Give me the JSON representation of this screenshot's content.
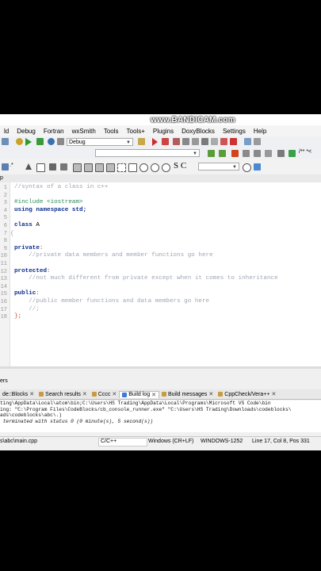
{
  "watermark": "www.BANDICAM.com",
  "menu": [
    "ld",
    "Debug",
    "Fortran",
    "wxSmith",
    "Tools",
    "Tools+",
    "Plugins",
    "DoxyBlocks",
    "Settings",
    "Help"
  ],
  "toolbar": {
    "build_target": "Debug",
    "comment_hint": "/** *<"
  },
  "toolbar2": {
    "search_letters": "S C"
  },
  "editor": {
    "tab_label": "p",
    "lines": [
      {
        "n": "1",
        "fold": "",
        "parts": [
          {
            "c": "comment",
            "t": "//syntax of a class in c++"
          }
        ]
      },
      {
        "n": "2",
        "fold": "",
        "parts": []
      },
      {
        "n": "3",
        "fold": "",
        "parts": [
          {
            "c": "pre",
            "t": "#include <iostream>"
          }
        ]
      },
      {
        "n": "4",
        "fold": "",
        "parts": [
          {
            "c": "kw",
            "t": "using namespace "
          },
          {
            "c": "kw",
            "t": "std;"
          }
        ]
      },
      {
        "n": "5",
        "fold": "",
        "parts": []
      },
      {
        "n": "6",
        "fold": "",
        "parts": [
          {
            "c": "kw",
            "t": "class "
          },
          {
            "c": "norm",
            "t": "A"
          }
        ]
      },
      {
        "n": "7",
        "fold": "{",
        "parts": []
      },
      {
        "n": "8",
        "fold": "",
        "parts": []
      },
      {
        "n": "9",
        "fold": "",
        "parts": [
          {
            "c": "kw",
            "t": "private"
          },
          {
            "c": "punc",
            "t": ":"
          }
        ]
      },
      {
        "n": "10",
        "fold": "",
        "parts": [
          {
            "c": "comment",
            "t": "    //private data members and member functions go here"
          }
        ]
      },
      {
        "n": "11",
        "fold": "",
        "parts": []
      },
      {
        "n": "12",
        "fold": "",
        "parts": [
          {
            "c": "kw",
            "t": "protected"
          },
          {
            "c": "punc",
            "t": ":"
          }
        ]
      },
      {
        "n": "13",
        "fold": "",
        "parts": [
          {
            "c": "comment",
            "t": "    //not much different from private except when it comes to inheritance"
          }
        ]
      },
      {
        "n": "14",
        "fold": "",
        "parts": []
      },
      {
        "n": "15",
        "fold": "",
        "parts": [
          {
            "c": "kw",
            "t": "public"
          },
          {
            "c": "punc",
            "t": ":"
          }
        ]
      },
      {
        "n": "16",
        "fold": "",
        "parts": [
          {
            "c": "comment",
            "t": "    //public member functions and data members go here"
          }
        ]
      },
      {
        "n": "17",
        "fold": "",
        "parts": [
          {
            "c": "comment",
            "t": "    //;"
          }
        ]
      },
      {
        "n": "18",
        "fold": "",
        "parts": [
          {
            "c": "punc",
            "t": "};"
          }
        ]
      }
    ]
  },
  "logs": {
    "panel_label": "ers",
    "tabs": [
      {
        "label": "de::Blocks",
        "active": false
      },
      {
        "label": "Search results",
        "active": false
      },
      {
        "label": "Cccc",
        "active": false
      },
      {
        "label": "Build log",
        "active": true
      },
      {
        "label": "Build messages",
        "active": false
      },
      {
        "label": "CppCheck/Vera++",
        "active": false
      }
    ],
    "text_lines": [
      "ting\\AppData\\Local\\atom\\bin;C:\\Users\\HS Trading\\AppData\\Local\\Programs\\Microsoft VS Code\\bin",
      "ing: \"C:\\Program Files\\CodeBlocks/cb_console_runner.exe\" \"C:\\Users\\HS Trading\\Downloads\\codeblocks\\",
      "ads\\codeblocks\\abc\\.)",
      " terminated with status 0 (0 minute(s), 5 second(s))"
    ]
  },
  "status": {
    "file": "s\\abc\\main.cpp",
    "language": "C/C++",
    "line_endings": "Windows (CR+LF)",
    "encoding": "WINDOWS-1252",
    "position": "Line 17, Col 8, Pos 331"
  }
}
